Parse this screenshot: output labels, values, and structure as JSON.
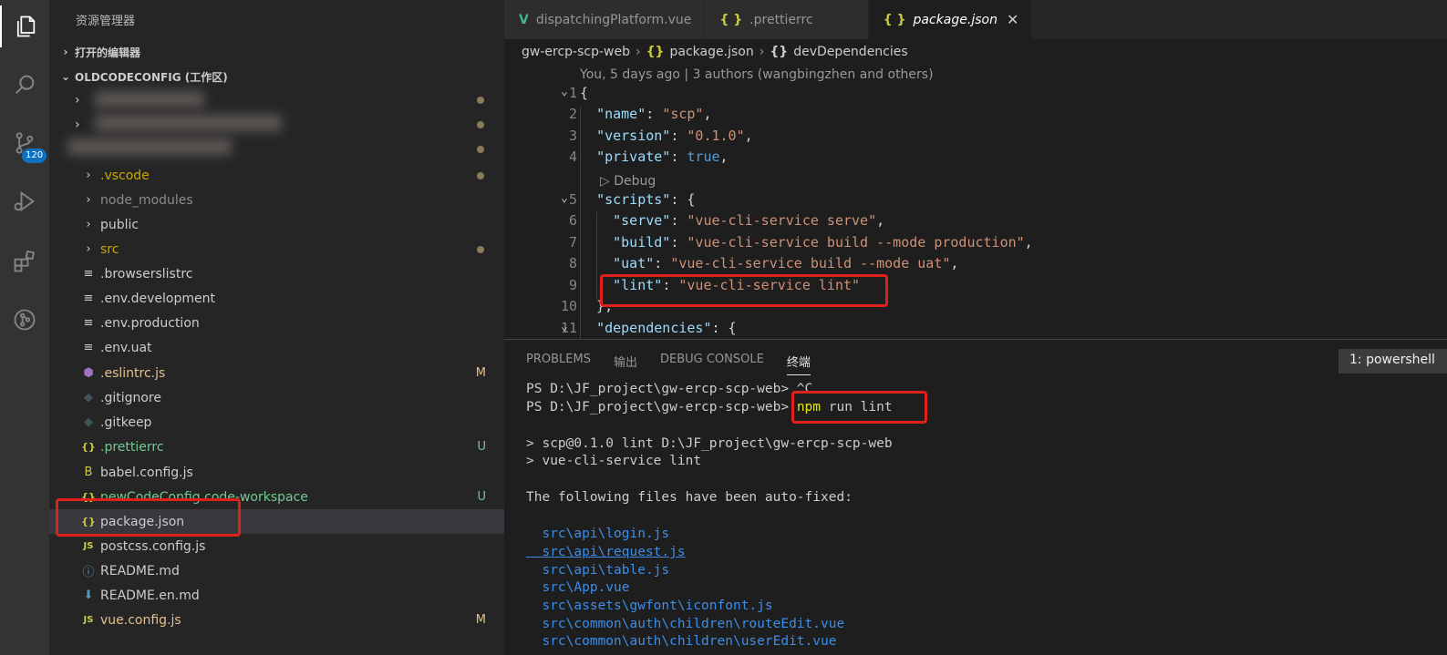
{
  "sidebar": {
    "title": "资源管理器",
    "open_editors": "打开的编辑器",
    "workspace": "OLDCODECONFIG (工作区)",
    "items": [
      {
        "name": ".vscode",
        "icon": "chevron-right-icon",
        "color": "#cca700",
        "status": ""
      },
      {
        "name": "node_modules",
        "icon": "chevron-right-icon",
        "color": "#8c8c8c",
        "status": ""
      },
      {
        "name": "public",
        "icon": "chevron-right-icon",
        "color": "#cccccc",
        "status": ""
      },
      {
        "name": "src",
        "icon": "chevron-right-icon",
        "color": "#cca700",
        "status": ""
      },
      {
        "name": ".browserslistrc",
        "icon": "text-file-icon",
        "color": "#cccccc",
        "status": ""
      },
      {
        "name": ".env.development",
        "icon": "text-file-icon",
        "color": "#cccccc",
        "status": ""
      },
      {
        "name": ".env.production",
        "icon": "text-file-icon",
        "color": "#cccccc",
        "status": ""
      },
      {
        "name": ".env.uat",
        "icon": "text-file-icon",
        "color": "#cccccc",
        "status": ""
      },
      {
        "name": ".eslintrc.js",
        "icon": "eslint-icon",
        "color": "#e2c08d",
        "status": "M"
      },
      {
        "name": ".gitignore",
        "icon": "git-icon",
        "color": "#cccccc",
        "status": ""
      },
      {
        "name": ".gitkeep",
        "icon": "git-icon",
        "color": "#cccccc",
        "status": ""
      },
      {
        "name": ".prettierrc",
        "icon": "json-icon",
        "color": "#73c991",
        "status": "U"
      },
      {
        "name": "babel.config.js",
        "icon": "babel-icon",
        "color": "#cccccc",
        "status": ""
      },
      {
        "name": "newCodeConfig.code-workspace",
        "icon": "json-icon",
        "color": "#73c991",
        "status": "U"
      },
      {
        "name": "package.json",
        "icon": "json-icon",
        "color": "#cccccc",
        "status": ""
      },
      {
        "name": "postcss.config.js",
        "icon": "js-icon",
        "color": "#cccccc",
        "status": ""
      },
      {
        "name": "README.md",
        "icon": "info-icon",
        "color": "#cccccc",
        "status": ""
      },
      {
        "name": "README.en.md",
        "icon": "download-icon",
        "color": "#cccccc",
        "status": ""
      },
      {
        "name": "vue.config.js",
        "icon": "js-icon",
        "color": "#e2c08d",
        "status": "M"
      }
    ]
  },
  "activity": {
    "source_control_badge": "120"
  },
  "tabs": [
    {
      "label": "dispatchingPlatform.vue",
      "icon": "V"
    },
    {
      "label": ".prettierrc",
      "icon": "{ }"
    },
    {
      "label": "package.json",
      "icon": "{ }",
      "close": "✕"
    }
  ],
  "breadcrumb": {
    "root": "gw-ercp-scp-web",
    "file": "package.json",
    "node": "devDependencies"
  },
  "codelens": {
    "blame": "You, 5 days ago | 3 authors (wangbingzhen and others)",
    "debug": "▷ Debug"
  },
  "code": [
    {
      "n": "1",
      "fold": "true",
      "parts": [
        [
          "p",
          "{"
        ]
      ]
    },
    {
      "n": "2",
      "parts": [
        [
          "p",
          "  "
        ],
        [
          "k",
          "\"name\""
        ],
        [
          "p",
          ": "
        ],
        [
          "s",
          "\"scp\""
        ],
        [
          "p",
          ","
        ]
      ]
    },
    {
      "n": "3",
      "parts": [
        [
          "p",
          "  "
        ],
        [
          "k",
          "\"version\""
        ],
        [
          "p",
          ": "
        ],
        [
          "s",
          "\"0.1.0\""
        ],
        [
          "p",
          ","
        ]
      ]
    },
    {
      "n": "4",
      "parts": [
        [
          "p",
          "  "
        ],
        [
          "k",
          "\"private\""
        ],
        [
          "p",
          ": "
        ],
        [
          "b",
          "true"
        ],
        [
          "p",
          ","
        ]
      ]
    },
    {
      "n": "5",
      "fold": "true",
      "parts": [
        [
          "p",
          "  "
        ],
        [
          "k",
          "\"scripts\""
        ],
        [
          "p",
          ": {"
        ]
      ]
    },
    {
      "n": "6",
      "parts": [
        [
          "p",
          "    "
        ],
        [
          "k",
          "\"serve\""
        ],
        [
          "p",
          ": "
        ],
        [
          "s",
          "\"vue-cli-service serve\""
        ],
        [
          "p",
          ","
        ]
      ]
    },
    {
      "n": "7",
      "parts": [
        [
          "p",
          "    "
        ],
        [
          "k",
          "\"build\""
        ],
        [
          "p",
          ": "
        ],
        [
          "s",
          "\"vue-cli-service build --mode production\""
        ],
        [
          "p",
          ","
        ]
      ]
    },
    {
      "n": "8",
      "parts": [
        [
          "p",
          "    "
        ],
        [
          "k",
          "\"uat\""
        ],
        [
          "p",
          ": "
        ],
        [
          "s",
          "\"vue-cli-service build --mode uat\""
        ],
        [
          "p",
          ","
        ]
      ]
    },
    {
      "n": "9",
      "parts": [
        [
          "p",
          "    "
        ],
        [
          "k",
          "\"lint\""
        ],
        [
          "p",
          ": "
        ],
        [
          "s",
          "\"vue-cli-service lint\""
        ]
      ]
    },
    {
      "n": "10",
      "parts": [
        [
          "p",
          "  },"
        ]
      ]
    },
    {
      "n": "11",
      "fold": "true",
      "parts": [
        [
          "p",
          "  "
        ],
        [
          "k",
          "\"dependencies\""
        ],
        [
          "p",
          ": {"
        ]
      ]
    }
  ],
  "panel": {
    "tabs": [
      "PROBLEMS",
      "输出",
      "DEBUG CONSOLE",
      "终端"
    ],
    "terminal_select": "1: powershell",
    "lines": [
      {
        "text": "PS D:\\JF_project\\gw-ercp-scp-web> ^C",
        "cls": ""
      },
      {
        "text": "",
        "cls": "",
        "prompt": "PS D:\\JF_project\\gw-ercp-scp-web> ",
        "cmd": "npm",
        "rest": " run lint"
      },
      {
        "text": "> scp@0.1.0 lint D:\\JF_project\\gw-ercp-scp-web",
        "cls": ""
      },
      {
        "text": "> vue-cli-service lint",
        "cls": ""
      },
      {
        "text": "The following files have been auto-fixed:",
        "cls": ""
      },
      {
        "text": "  src\\api\\login.js",
        "cls": "link"
      },
      {
        "text": "  src\\api\\request.js",
        "cls": "link ul"
      },
      {
        "text": "  src\\api\\table.js",
        "cls": "link"
      },
      {
        "text": "  src\\App.vue",
        "cls": "link"
      },
      {
        "text": "  src\\assets\\gwfont\\iconfont.js",
        "cls": "link"
      },
      {
        "text": "  src\\common\\auth\\children\\routeEdit.vue",
        "cls": "link"
      },
      {
        "text": "  src\\common\\auth\\children\\userEdit.vue",
        "cls": "link"
      }
    ]
  }
}
